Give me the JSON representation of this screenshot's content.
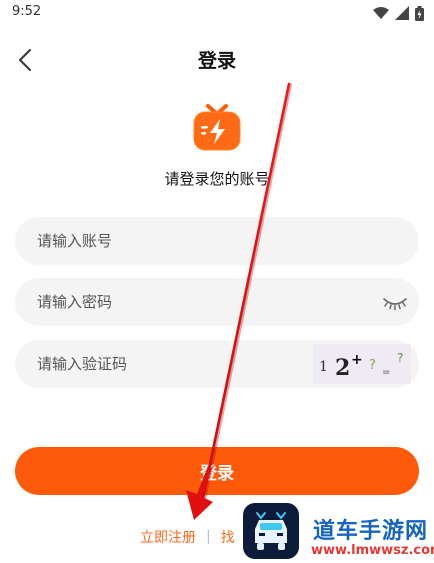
{
  "status_bar": {
    "time": "9:52"
  },
  "header": {
    "title": "登录"
  },
  "subtitle": "请登录您的账号",
  "form": {
    "account_placeholder": "请输入账号",
    "password_placeholder": "请输入密码",
    "code_placeholder": "请输入验证码",
    "captcha_text": "1 2+ ? ="
  },
  "login_button": "登录",
  "links": {
    "register": "立即注册",
    "separator": "|",
    "forgot": "找"
  },
  "watermark": {
    "name": "道车手游网",
    "url": "www.lmwwsz.com"
  },
  "colors": {
    "accent": "#ff5a0a",
    "link": "#ff6a1a",
    "field_bg": "#f4f4f4",
    "arrow": "#e01010"
  },
  "icons": [
    "back-icon",
    "wifi-icon",
    "signal-icon",
    "battery-icon",
    "tv-logo-icon",
    "eye-closed-icon",
    "car-icon"
  ]
}
